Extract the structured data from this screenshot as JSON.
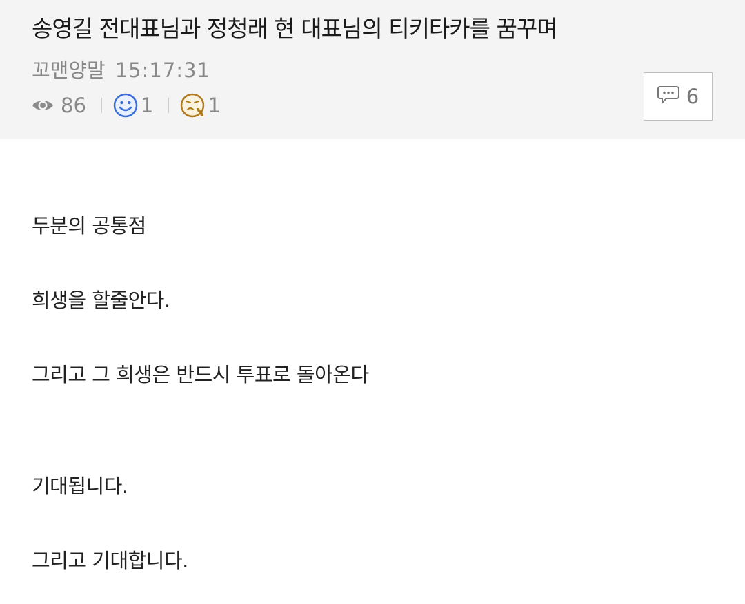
{
  "post": {
    "title": "송영길 전대표님과 정청래 현 대표님의 티키타카를 꿈꾸며",
    "author": "꼬맨양말",
    "time": "15:17:31",
    "views": "86",
    "likes": "1",
    "dislikes": "1",
    "comments": "6"
  },
  "icons": {
    "views": "eye-icon",
    "likes": "smiley-face-icon",
    "dislikes": "disgusted-face-icon",
    "comments": "speech-bubble-icon"
  },
  "colors": {
    "header_bg": "#f4f4f4",
    "smiley_blue": "#3a6fd8",
    "dislike_gold": "#b07a1e"
  },
  "content": {
    "lines": [
      "두분의 공통점",
      "희생을 할줄안다.",
      "그리고 그 희생은 반드시 투표로 돌아온다",
      "기대됩니다.",
      "그리고 기대합니다."
    ]
  }
}
